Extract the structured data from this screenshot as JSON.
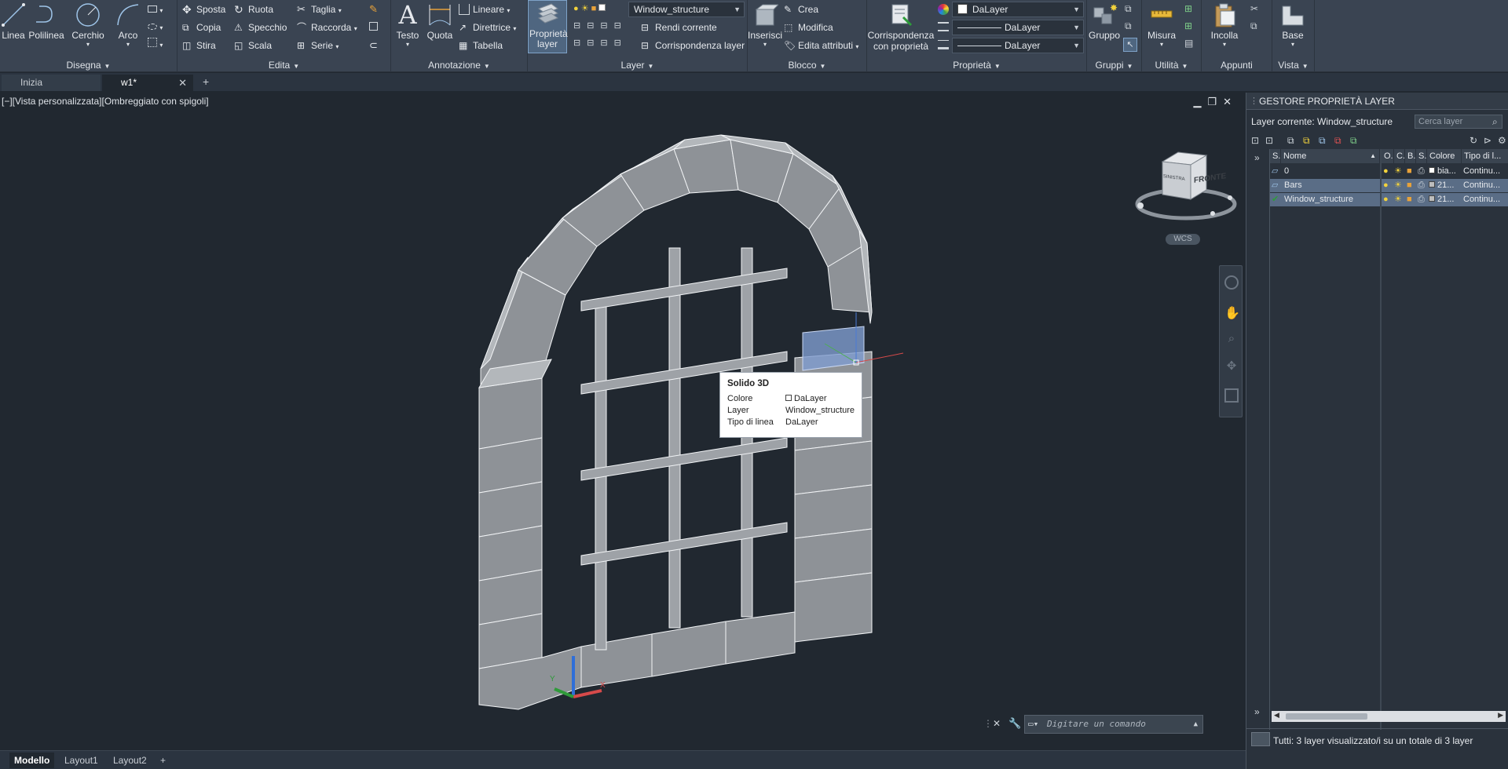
{
  "ribbon": {
    "draw": {
      "title": "Disegna",
      "linea": "Linea",
      "polilinea": "Polilinea",
      "cerchio": "Cerchio",
      "arco": "Arco"
    },
    "edit": {
      "title": "Edita",
      "sposta": "Sposta",
      "ruota": "Ruota",
      "taglia": "Taglia",
      "copia": "Copia",
      "specchio": "Specchio",
      "raccorda": "Raccorda",
      "stira": "Stira",
      "scala": "Scala",
      "serie": "Serie"
    },
    "annotation": {
      "title": "Annotazione",
      "testo": "Testo",
      "quota": "Quota",
      "lineare": "Lineare",
      "direttrice": "Direttrice",
      "tabella": "Tabella"
    },
    "layer": {
      "title": "Layer",
      "proprieta_layer": "Proprietà layer",
      "current_layer": "Window_structure",
      "rendi_corrente": "Rendi corrente",
      "corrispondenza_layer": "Corrispondenza layer"
    },
    "block": {
      "title": "Blocco",
      "inserisci": "Inserisci",
      "crea": "Crea",
      "modifica": "Modifica",
      "edita_attributi": "Edita attributi"
    },
    "properties": {
      "title": "Proprietà",
      "corrispondenza": "Corrispondenza con proprietà",
      "color": "DaLayer",
      "linetype": "DaLayer",
      "lineweight": "DaLayer"
    },
    "groups": {
      "title": "Gruppi",
      "gruppo": "Gruppo"
    },
    "utility": {
      "title": "Utilità",
      "misura": "Misura"
    },
    "clipboard": {
      "title": "Appunti",
      "incolla": "Incolla"
    },
    "view": {
      "title": "Vista",
      "base": "Base"
    }
  },
  "tabs": [
    {
      "label": "Inizia"
    },
    {
      "label": "w1*"
    }
  ],
  "viewport": {
    "label": "[−][Vista personalizzata][Ombreggiato con spigoli]",
    "viewcube_face": "FRONTE",
    "viewcube_side": "SINISTRA",
    "wcs": "WCS"
  },
  "tooltip": {
    "title": "Solido 3D",
    "rows": [
      {
        "key": "Colore",
        "value": "DaLayer"
      },
      {
        "key": "Layer",
        "value": "Window_structure"
      },
      {
        "key": "Tipo di linea",
        "value": "DaLayer"
      }
    ]
  },
  "command": {
    "placeholder": "Digitare un comando"
  },
  "layer_palette": {
    "title": "GESTORE PROPRIETÀ LAYER",
    "current": "Layer corrente: Window_structure",
    "search_placeholder": "Cerca layer",
    "columns": [
      "S..",
      "Nome",
      "O..",
      "C..",
      "B..",
      "S..",
      "Colore",
      "Tipo di l..."
    ],
    "layers": [
      {
        "name": "0",
        "color": "bia...",
        "linetype": "Continu...",
        "selected": false
      },
      {
        "name": "Bars",
        "color": "21...",
        "linetype": "Continu...",
        "selected": true
      },
      {
        "name": "Window_structure",
        "color": "21...",
        "linetype": "Continu...",
        "selected": true
      }
    ],
    "status": "Tutti: 3 layer visualizzato/i su un totale di 3 layer"
  },
  "layout_tabs": [
    {
      "label": "Modello"
    },
    {
      "label": "Layout1"
    },
    {
      "label": "Layout2"
    }
  ],
  "colors": {
    "ribbon_bg": "#3a4452",
    "viewport_bg": "#212830",
    "selection": "#5a6d86",
    "accent": "#1f8fd6"
  }
}
